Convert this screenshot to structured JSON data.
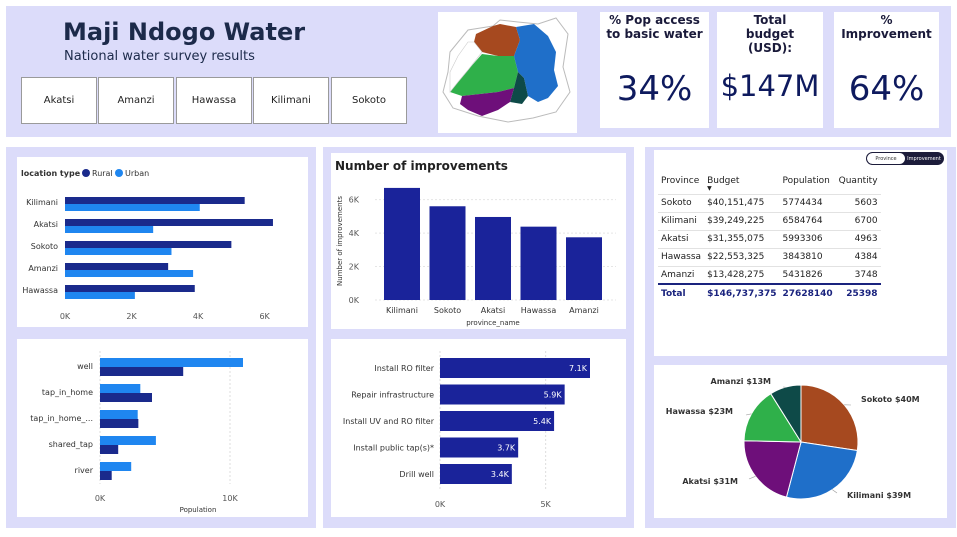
{
  "header": {
    "title": "Maji Ndogo Water",
    "subtitle": "National water survey results",
    "slicers": [
      "Akatsi",
      "Amanzi",
      "Hawassa",
      "Kilimani",
      "Sokoto"
    ]
  },
  "kpis": [
    {
      "label": "% Pop access to basic water",
      "value": "34%"
    },
    {
      "label": "Total budget (USD):",
      "value": "$147M"
    },
    {
      "label": "% Improvement",
      "value": "64%"
    }
  ],
  "colors": {
    "rural": "#1a2a8c",
    "urban": "#1f86f0",
    "improve": "#1a239a",
    "panel": "#dcdcfa",
    "akatsi": "#6e0f7a",
    "kilimani": "#1f6fc9",
    "sokoto": "#a6491f",
    "hawassa": "#2fb04a",
    "amanzi": "#0e4a48"
  },
  "location_chart": {
    "legend_title": "location type",
    "legend": [
      "Rural",
      "Urban"
    ],
    "chart_data": {
      "type": "bar",
      "orientation": "horizontal",
      "categories": [
        "Kilimani",
        "Akatsi",
        "Sokoto",
        "Amanzi",
        "Hawassa"
      ],
      "series": [
        {
          "name": "Rural",
          "values": [
            5400,
            6250,
            5000,
            3100,
            3900
          ]
        },
        {
          "name": "Urban",
          "values": [
            4050,
            2650,
            3200,
            3850,
            2100
          ]
        }
      ],
      "xlim": [
        0,
        7000
      ],
      "ticks": [
        "0K",
        "2K",
        "4K",
        "6K"
      ],
      "tick_values": [
        0,
        2000,
        4000,
        6000
      ]
    }
  },
  "source_chart": {
    "chart_data": {
      "type": "bar",
      "orientation": "horizontal",
      "categories": [
        "well",
        "tap_in_home",
        "tap_in_home_...",
        "shared_tap",
        "river"
      ],
      "series": [
        {
          "name": "Urban",
          "values": [
            11000,
            3100,
            2900,
            4300,
            2400
          ]
        },
        {
          "name": "Rural",
          "values": [
            6400,
            4000,
            2950,
            1400,
            900
          ]
        }
      ],
      "xlim": [
        0,
        13000
      ],
      "ticks": [
        "0K",
        "10K"
      ],
      "tick_values": [
        0,
        10000
      ],
      "xlabel": "Population"
    }
  },
  "improvements_chart": {
    "title": "Number of improvements",
    "chart_data": {
      "type": "bar",
      "categories": [
        "Kilimani",
        "Sokoto",
        "Akatsi",
        "Hawassa",
        "Amanzi"
      ],
      "values": [
        6700,
        5603,
        4963,
        4384,
        3748
      ],
      "ylim": [
        0,
        7000
      ],
      "ticks": [
        "0K",
        "2K",
        "4K",
        "6K"
      ],
      "tick_values": [
        0,
        2000,
        4000,
        6000
      ],
      "xlabel": "province_name",
      "ylabel": "Number of improvements"
    }
  },
  "actions_chart": {
    "chart_data": {
      "type": "bar",
      "orientation": "horizontal",
      "categories": [
        "Install RO filter",
        "Repair infrastructure",
        "Install UV and RO filter",
        "Install public tap(s)*",
        "Drill well"
      ],
      "values": [
        7100,
        5900,
        5400,
        3700,
        3400
      ],
      "labels": [
        "7.1K",
        "5.9K",
        "5.4K",
        "3.7K",
        "3.4K"
      ],
      "xlim": [
        0,
        7200
      ],
      "ticks": [
        "0K",
        "5K"
      ],
      "tick_values": [
        0,
        5000
      ]
    }
  },
  "toggle": {
    "left": "Province",
    "right": "Improvement"
  },
  "table": {
    "headers": [
      "Province",
      "Budget",
      "Population",
      "Quantity"
    ],
    "rows": [
      [
        "Sokoto",
        "$40,151,475",
        "5774434",
        "5603"
      ],
      [
        "Kilimani",
        "$39,249,225",
        "6584764",
        "6700"
      ],
      [
        "Akatsi",
        "$31,355,075",
        "5993306",
        "4963"
      ],
      [
        "Hawassa",
        "$22,553,325",
        "3843810",
        "4384"
      ],
      [
        "Amanzi",
        "$13,428,275",
        "5431826",
        "3748"
      ]
    ],
    "total": [
      "Total",
      "$146,737,375",
      "27628140",
      "25398"
    ]
  },
  "pie_chart": {
    "chart_data": {
      "type": "pie",
      "slices": [
        {
          "name": "Sokoto",
          "value": 40,
          "label": "Sokoto $40M"
        },
        {
          "name": "Kilimani",
          "value": 39,
          "label": "Kilimani $39M"
        },
        {
          "name": "Akatsi",
          "value": 31,
          "label": "Akatsi $31M"
        },
        {
          "name": "Hawassa",
          "value": 23,
          "label": "Hawassa $23M"
        },
        {
          "name": "Amanzi",
          "value": 13,
          "label": "Amanzi $13M"
        }
      ]
    }
  }
}
